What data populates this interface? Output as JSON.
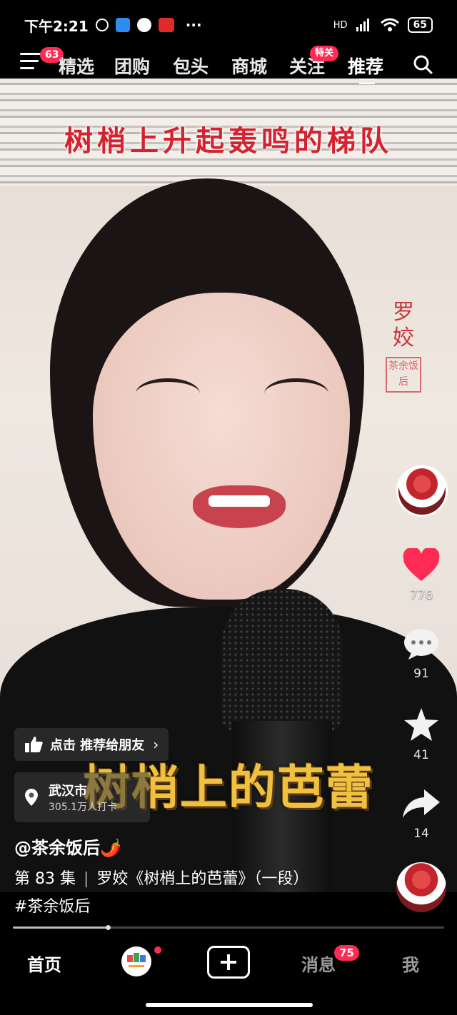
{
  "status": {
    "time": "下午2:21",
    "network": "HD",
    "battery": "65"
  },
  "topnav": {
    "menu_badge": "63",
    "tabs": [
      {
        "label": "精选"
      },
      {
        "label": "团购"
      },
      {
        "label": "包头"
      },
      {
        "label": "商城"
      },
      {
        "label": "关注",
        "badge": "特关"
      },
      {
        "label": "推荐",
        "active": true
      }
    ]
  },
  "video": {
    "banner_text": "树梢上升起轰鸣的梯队",
    "seal_name": "罗姣",
    "seal_stamp": "茶余饭后",
    "lyric": "树梢上的芭蕾"
  },
  "rail": {
    "likes": "776",
    "comments": "91",
    "favorites": "41",
    "shares": "14",
    "like_color": "#fe2c55"
  },
  "overlay": {
    "recommend_chip": "点击 推荐给朋友",
    "location_name": "武汉市",
    "location_sub": "305.1万人打卡",
    "author": "@茶余饭后🌶️",
    "episode": "第 83 集",
    "title": "罗姣《树梢上的芭蕾》（一段）",
    "hashtag": "#茶余饭后",
    "progress": 0.22
  },
  "bottomnav": {
    "home": "首页",
    "messages": "消息",
    "messages_badge": "75",
    "me": "我"
  }
}
